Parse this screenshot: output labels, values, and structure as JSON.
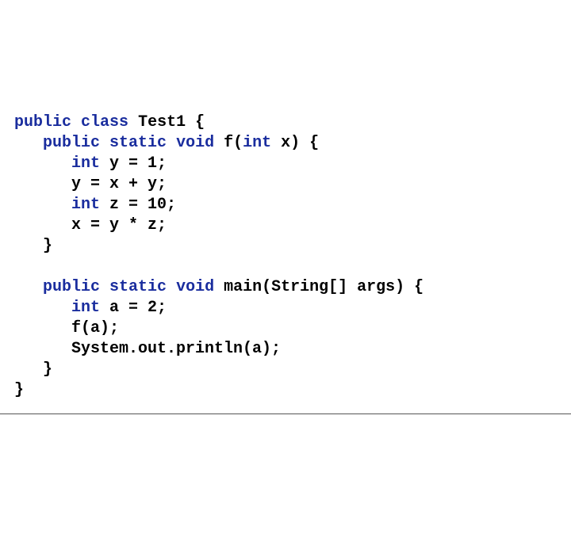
{
  "code": {
    "kw_public": "public",
    "kw_class": "class",
    "kw_static": "static",
    "kw_void": "void",
    "kw_int": "int",
    "class_name": "Test1",
    "method_f_sig_open": " f(",
    "method_f_param": " x) {",
    "line3_a": " y = 1;",
    "line4": "      y = x + y;",
    "line5_a": " z = 10;",
    "line6": "      x = y * z;",
    "line7": "   }",
    "blank": "",
    "method_main_sig_open": " main(String[] args) {",
    "line10_a": " a = 2;",
    "line11": "      f(a);",
    "line12": "      System.out.println(a);",
    "line13": "   }",
    "line14": "}",
    "sp1": " ",
    "sp3": "   ",
    "sp6": "      ",
    "open_brace": " {"
  }
}
